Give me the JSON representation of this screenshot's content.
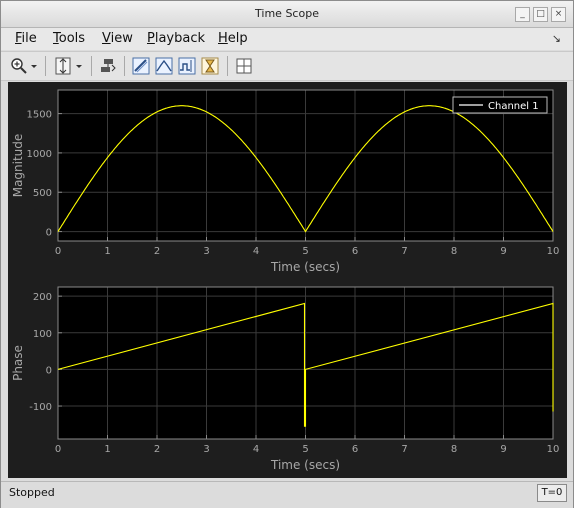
{
  "window": {
    "title": "Time Scope",
    "buttons": [
      "_",
      "□",
      "×"
    ]
  },
  "menu": {
    "items": [
      {
        "label": "File",
        "mnemonic": "F"
      },
      {
        "label": "Tools",
        "mnemonic": "T"
      },
      {
        "label": "View",
        "mnemonic": "V"
      },
      {
        "label": "Playback",
        "mnemonic": "P"
      },
      {
        "label": "Help",
        "mnemonic": "H"
      }
    ],
    "overflow_icon": "undock-arrow-icon"
  },
  "toolbar": {
    "tools": [
      "zoom-in-icon",
      "dropdown-icon",
      "scale-axes-icon",
      "dropdown-icon",
      "highlight-simulink-icon",
      "cursor-measurements-icon",
      "peak-finder-icon",
      "signal-statistics-icon",
      "bilevel-measurements-icon",
      "layout-icon"
    ]
  },
  "status": {
    "text": "Stopped",
    "time": "T=0"
  },
  "colors": {
    "trace": "#ffff00",
    "plot_bg": "#000000",
    "figure_bg": "#1e1e1e",
    "axis_text": "#a8a8a8"
  },
  "chart_data": [
    {
      "type": "line",
      "ylabel": "Magnitude",
      "xlabel": "Time (secs)",
      "xlim": [
        0,
        10
      ],
      "ylim": [
        -120,
        1800
      ],
      "xticks": [
        0,
        1,
        2,
        3,
        4,
        5,
        6,
        7,
        8,
        9,
        10
      ],
      "yticks": [
        0,
        500,
        1000,
        1500
      ],
      "grid": true,
      "legend": {
        "position": "top-right",
        "entries": [
          "Channel 1"
        ]
      },
      "series": [
        {
          "name": "Channel 1",
          "x": [
            0,
            0.5,
            1,
            1.5,
            2,
            2.5,
            3,
            3.5,
            4,
            4.5,
            5,
            5.5,
            6,
            6.5,
            7,
            7.5,
            8,
            8.5,
            9,
            9.5,
            10
          ],
          "y": [
            0,
            494,
            940,
            1294,
            1522,
            1600,
            1522,
            1294,
            940,
            494,
            0,
            494,
            940,
            1294,
            1522,
            1600,
            1522,
            1294,
            940,
            494,
            0
          ]
        }
      ]
    },
    {
      "type": "line",
      "ylabel": "Phase",
      "xlabel": "Time (secs)",
      "xlim": [
        0,
        10
      ],
      "ylim": [
        -190,
        225
      ],
      "xticks": [
        0,
        1,
        2,
        3,
        4,
        5,
        6,
        7,
        8,
        9,
        10
      ],
      "yticks": [
        -100,
        0,
        100,
        200
      ],
      "grid": true,
      "series": [
        {
          "name": "Channel 1",
          "x": [
            0,
            4.98,
            4.98,
            5,
            5,
            10,
            10
          ],
          "y": [
            0,
            180,
            -155,
            -155,
            0,
            180,
            -115
          ]
        }
      ]
    }
  ]
}
